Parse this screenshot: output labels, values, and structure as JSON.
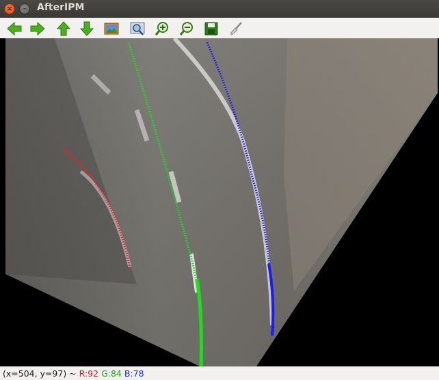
{
  "window": {
    "title": "AfterIPM",
    "close_glyph": "×",
    "minimize_glyph": "–"
  },
  "toolbar": {
    "buttons": [
      {
        "name": "pan-left",
        "icon": "arrow-left-icon"
      },
      {
        "name": "pan-right",
        "icon": "arrow-right-icon"
      },
      {
        "name": "pan-up",
        "icon": "arrow-up-icon"
      },
      {
        "name": "pan-down",
        "icon": "arrow-down-icon"
      },
      {
        "name": "zoom-original",
        "icon": "image-icon"
      },
      {
        "name": "zoom-fit",
        "icon": "zoom-fit-icon"
      },
      {
        "name": "zoom-in",
        "icon": "zoom-in-icon"
      },
      {
        "name": "zoom-out",
        "icon": "zoom-out-icon"
      },
      {
        "name": "save",
        "icon": "save-icon"
      },
      {
        "name": "properties",
        "icon": "brush-icon"
      }
    ],
    "colors": {
      "arrow": "#3fa31a",
      "arrow_dark": "#2a7a10"
    }
  },
  "image": {
    "description_colors": {
      "left_lane": "#ff1a1a",
      "center_lane": "#19e019",
      "right_lane": "#1a1aff",
      "road": "#6e6c67",
      "background": "#000000"
    }
  },
  "status": {
    "coord": "(x=504, y=97) ~",
    "r": "R:92",
    "g": "G:84",
    "b": "B:78"
  }
}
